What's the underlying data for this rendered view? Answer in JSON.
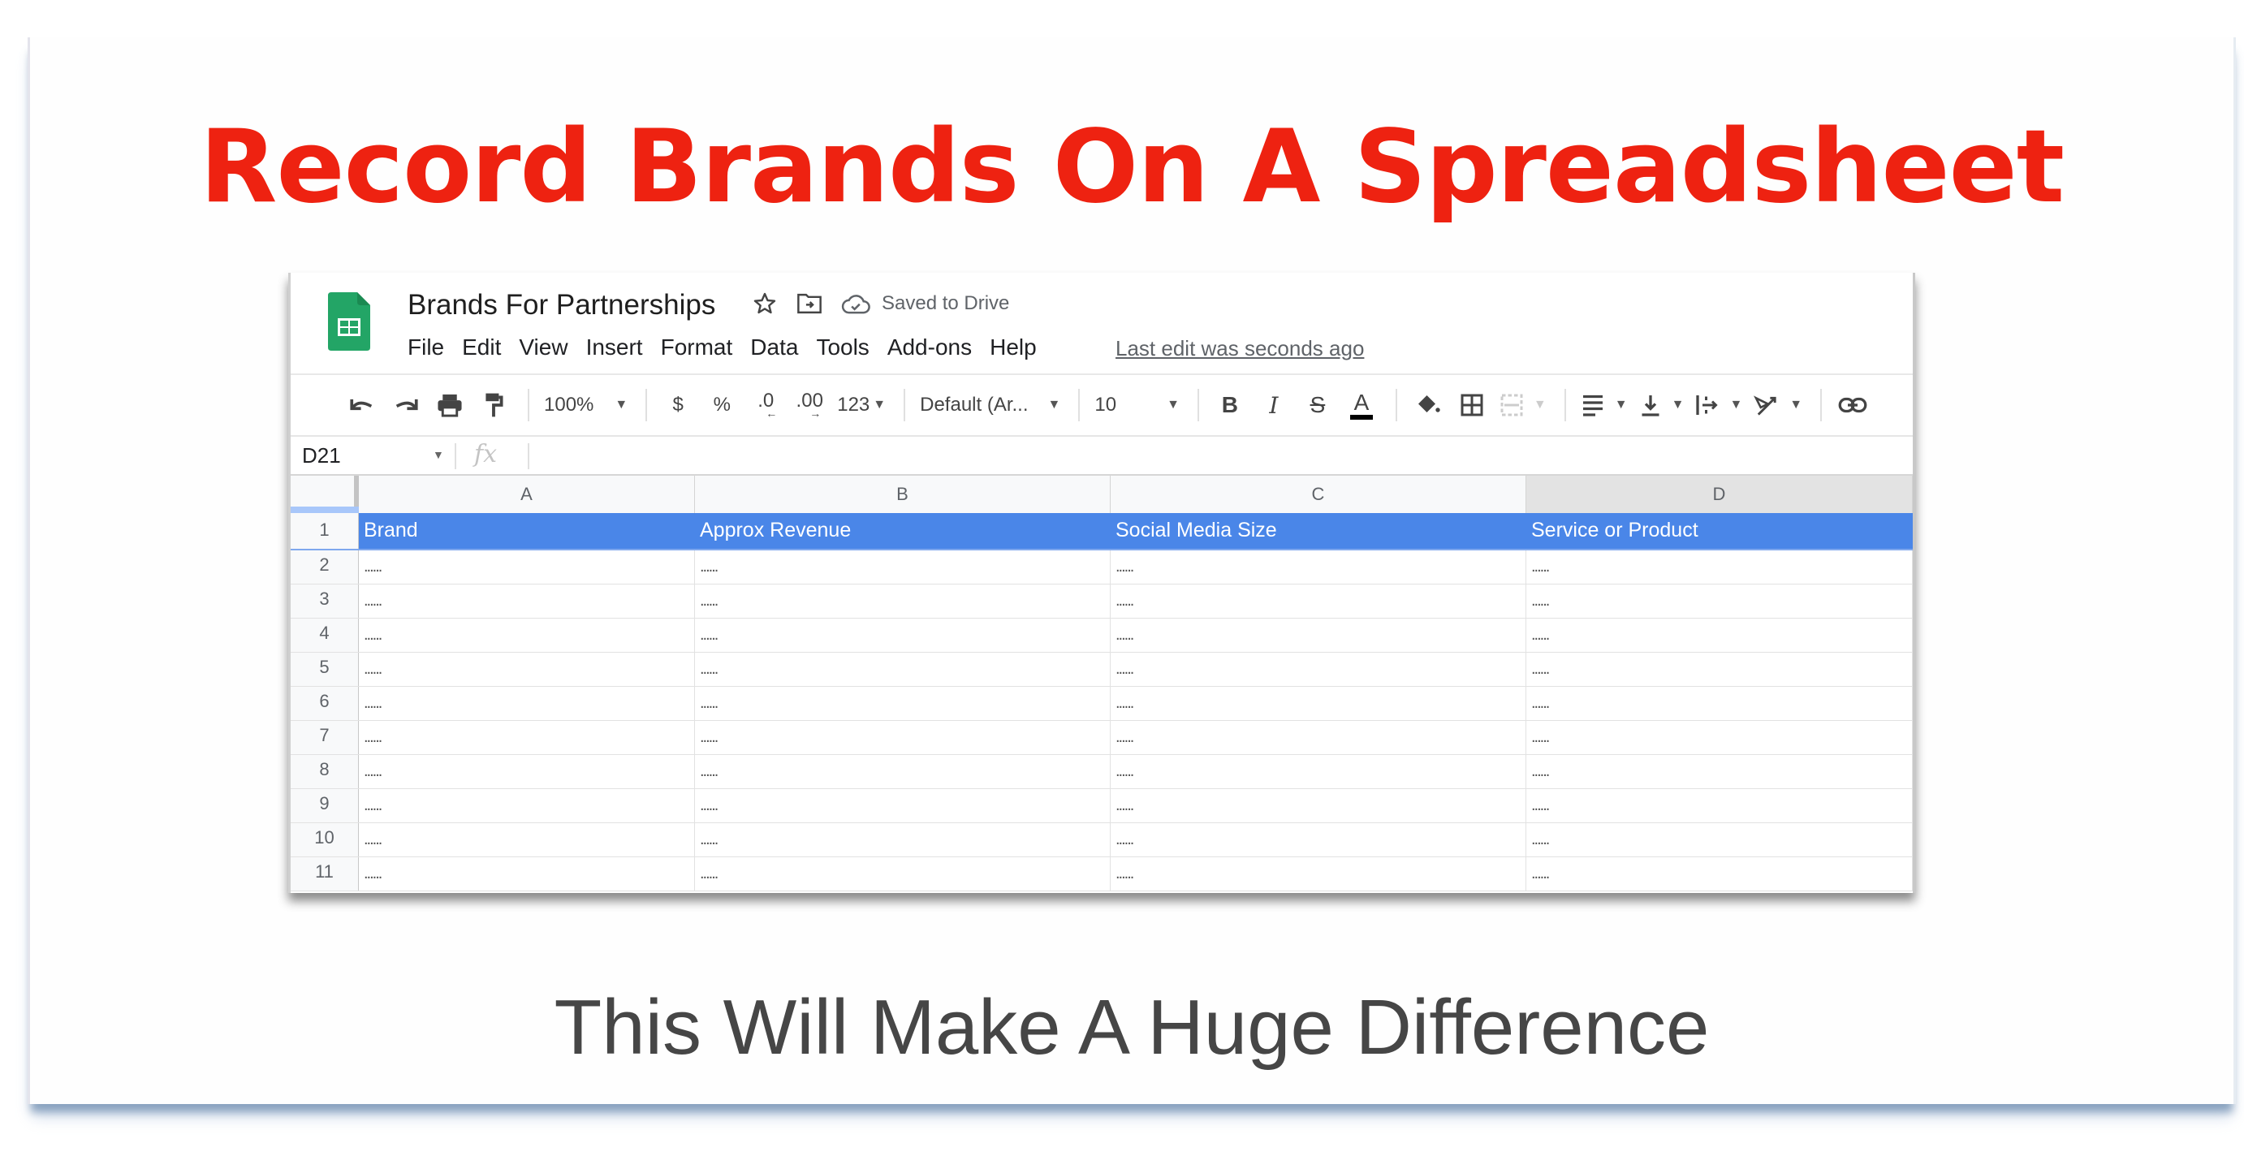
{
  "slide": {
    "title": "Record Brands On A Spreadsheet",
    "subtitle": "This Will Make A Huge Difference",
    "title_color": "#ee2211",
    "subtitle_color": "#464646"
  },
  "sheet": {
    "app_icon": "google-sheets-logo",
    "doc_title": "Brands For Partnerships",
    "title_icons": [
      "star-icon",
      "move-to-folder-icon",
      "cloud-saved-icon"
    ],
    "saved_status": "Saved to Drive",
    "menu": [
      "File",
      "Edit",
      "View",
      "Insert",
      "Format",
      "Data",
      "Tools",
      "Add-ons",
      "Help"
    ],
    "last_edit": "Last edit was seconds ago",
    "toolbar": {
      "zoom": "100%",
      "currency": "$",
      "percent": "%",
      "decrease_decimal": ".0",
      "increase_decimal": ".00",
      "more_formats": "123",
      "font": "Default (Ar...",
      "font_size": "10",
      "bold": "B",
      "italic": "I",
      "strikethrough": "S",
      "text_color": "A"
    },
    "name_box": "D21",
    "fx_label": "fx",
    "formula_value": "",
    "columns": [
      "A",
      "B",
      "C",
      "D"
    ],
    "selected_column": "D",
    "header_color": "#4a86e8",
    "rows": [
      {
        "num": "1",
        "cells": [
          "Brand",
          "Approx Revenue",
          "Social Media Size",
          "Service or Product"
        ]
      },
      {
        "num": "2",
        "cells": [
          "......",
          "......",
          "......",
          "......"
        ]
      },
      {
        "num": "3",
        "cells": [
          "......",
          "......",
          "......",
          "......"
        ]
      },
      {
        "num": "4",
        "cells": [
          "......",
          "......",
          "......",
          "......"
        ]
      },
      {
        "num": "5",
        "cells": [
          "......",
          "......",
          "......",
          "......"
        ]
      },
      {
        "num": "6",
        "cells": [
          "......",
          "......",
          "......",
          "......"
        ]
      },
      {
        "num": "7",
        "cells": [
          "......",
          "......",
          "......",
          "......"
        ]
      },
      {
        "num": "8",
        "cells": [
          "......",
          "......",
          "......",
          "......"
        ]
      },
      {
        "num": "9",
        "cells": [
          "......",
          "......",
          "......",
          "......"
        ]
      },
      {
        "num": "10",
        "cells": [
          "......",
          "......",
          "......",
          "......"
        ]
      },
      {
        "num": "11",
        "cells": [
          "......",
          "......",
          "......",
          "......"
        ]
      }
    ]
  }
}
